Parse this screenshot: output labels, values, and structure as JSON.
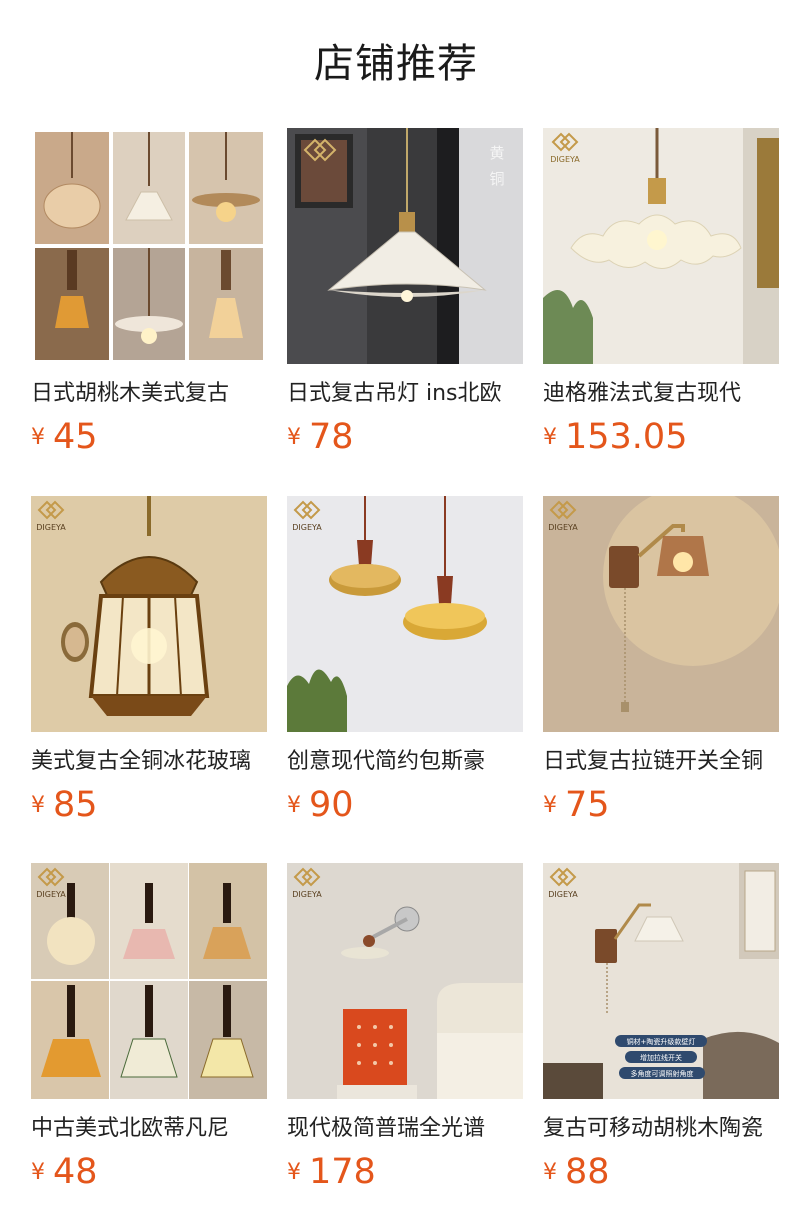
{
  "page": {
    "title": "店铺推荐",
    "currency": "¥",
    "price_color": "#e4561b",
    "brand_mark": "DIGEYA",
    "brand_sub": "迪格雅"
  },
  "products": [
    {
      "name": "日式胡桃木美式复古",
      "price": "45",
      "image": "six-glass-pendant-collage-icon"
    },
    {
      "name": "日式复古吊灯 ins北欧",
      "price": "78",
      "image": "pleated-ceramic-pendant-icon",
      "image_badge": [
        "黄",
        "铜"
      ]
    },
    {
      "name": "迪格雅法式复古现代",
      "price": "153.05",
      "image": "ruffled-glass-pendant-icon"
    },
    {
      "name": "美式复古全铜冰花玻璃",
      "price": "85",
      "image": "brass-lantern-pendant-icon"
    },
    {
      "name": "创意现代简约包斯豪",
      "price": "90",
      "image": "amber-double-pendant-icon"
    },
    {
      "name": "日式复古拉链开关全铜",
      "price": "75",
      "image": "pull-chain-wall-sconce-icon"
    },
    {
      "name": "中古美式北欧蒂凡尼",
      "price": "48",
      "image": "tiffany-pendant-collage-icon"
    },
    {
      "name": "现代极简普瑞全光谱",
      "price": "178",
      "image": "minimal-swing-wall-lamp-icon"
    },
    {
      "name": "复古可移动胡桃木陶瓷",
      "price": "88",
      "image": "ceramic-wall-lamp-icon",
      "image_labels": [
        "铜材+陶瓷升级款壁灯",
        "增加拉线开关",
        "多角度可调照射角度"
      ]
    }
  ]
}
